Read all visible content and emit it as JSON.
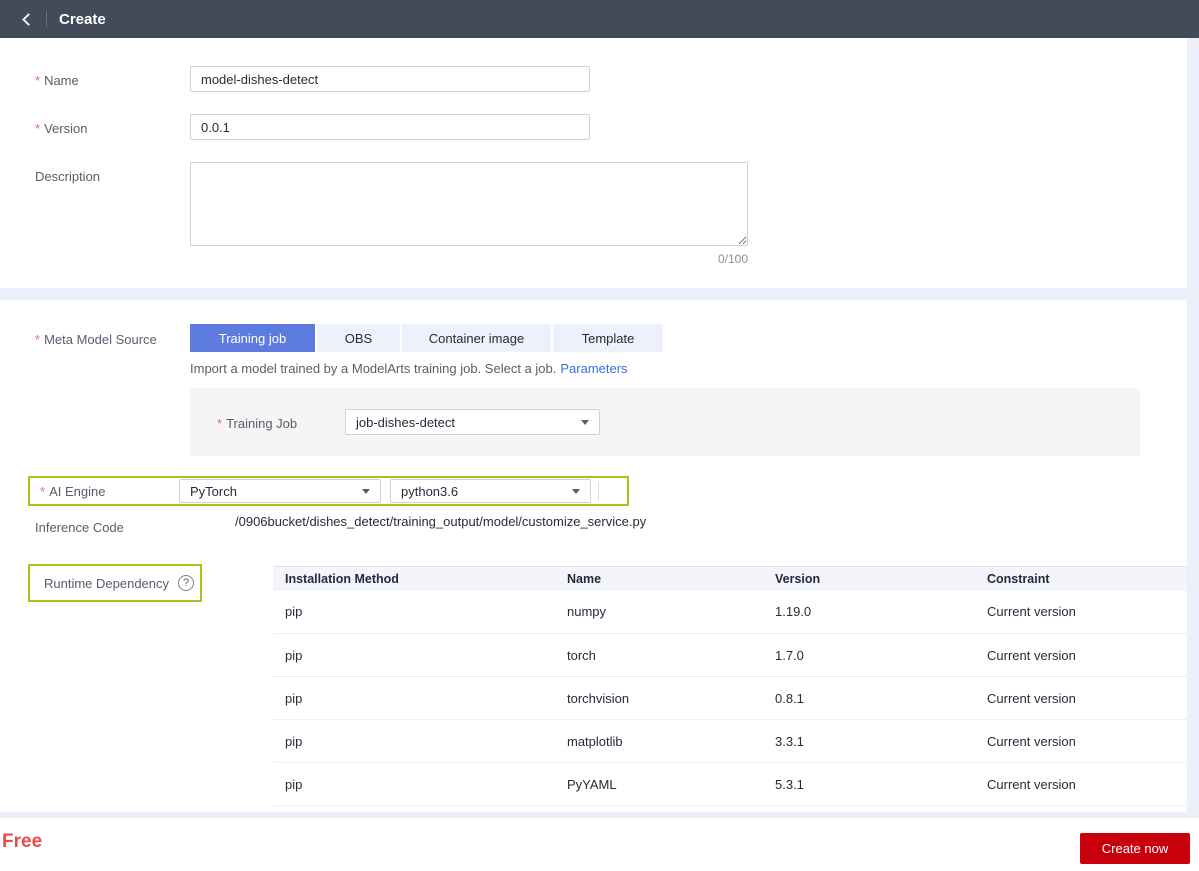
{
  "ui": {
    "required_marker": "*",
    "help_icon_glyph": "?"
  },
  "colors": {
    "header_bg": "#434a59",
    "accent_blue": "#5e7ce0",
    "link_blue": "#3d6dea",
    "highlight_green": "#9fc818",
    "button_red": "#c7000b",
    "free_red": "#e74d48",
    "page_bg": "#edf0fa"
  },
  "header": {
    "title": "Create",
    "back_icon": "chevron-left"
  },
  "form": {
    "name": {
      "label": "Name",
      "required": true,
      "value": "model-dishes-detect",
      "placeholder": ""
    },
    "version": {
      "label": "Version",
      "required": true,
      "value": "0.0.1",
      "placeholder": ""
    },
    "description": {
      "label": "Description",
      "value": "",
      "placeholder": "",
      "counter": "0/100"
    }
  },
  "meta": {
    "label": "Meta Model Source",
    "required": true,
    "tabs": [
      {
        "label": "Training job",
        "active": true
      },
      {
        "label": "OBS",
        "active": false
      },
      {
        "label": "Container image",
        "active": false
      },
      {
        "label": "Template",
        "active": false
      }
    ],
    "helper_text": "Import a model trained by a ModelArts training job. Select a job.",
    "helper_link": "Parameters",
    "training_job": {
      "label": "Training Job",
      "required": true,
      "value": "job-dishes-detect"
    },
    "ai_engine": {
      "label": "AI Engine",
      "required": true,
      "engine_value": "PyTorch",
      "python_value": "python3.6"
    },
    "inference_code": {
      "label": "Inference Code",
      "value": "/0906bucket/dishes_detect/training_output/model/customize_service.py"
    }
  },
  "runtime": {
    "label": "Runtime Dependency",
    "table": {
      "columns": [
        "Installation Method",
        "Name",
        "Version",
        "Constraint"
      ],
      "rows": [
        [
          "pip",
          "numpy",
          "1.19.0",
          "Current version"
        ],
        [
          "pip",
          "torch",
          "1.7.0",
          "Current version"
        ],
        [
          "pip",
          "torchvision",
          "0.8.1",
          "Current version"
        ],
        [
          "pip",
          "matplotlib",
          "3.3.1",
          "Current version"
        ],
        [
          "pip",
          "PyYAML",
          "5.3.1",
          "Current version"
        ]
      ]
    }
  },
  "footer": {
    "free_label": "Free",
    "create_button_label": "Create now"
  }
}
